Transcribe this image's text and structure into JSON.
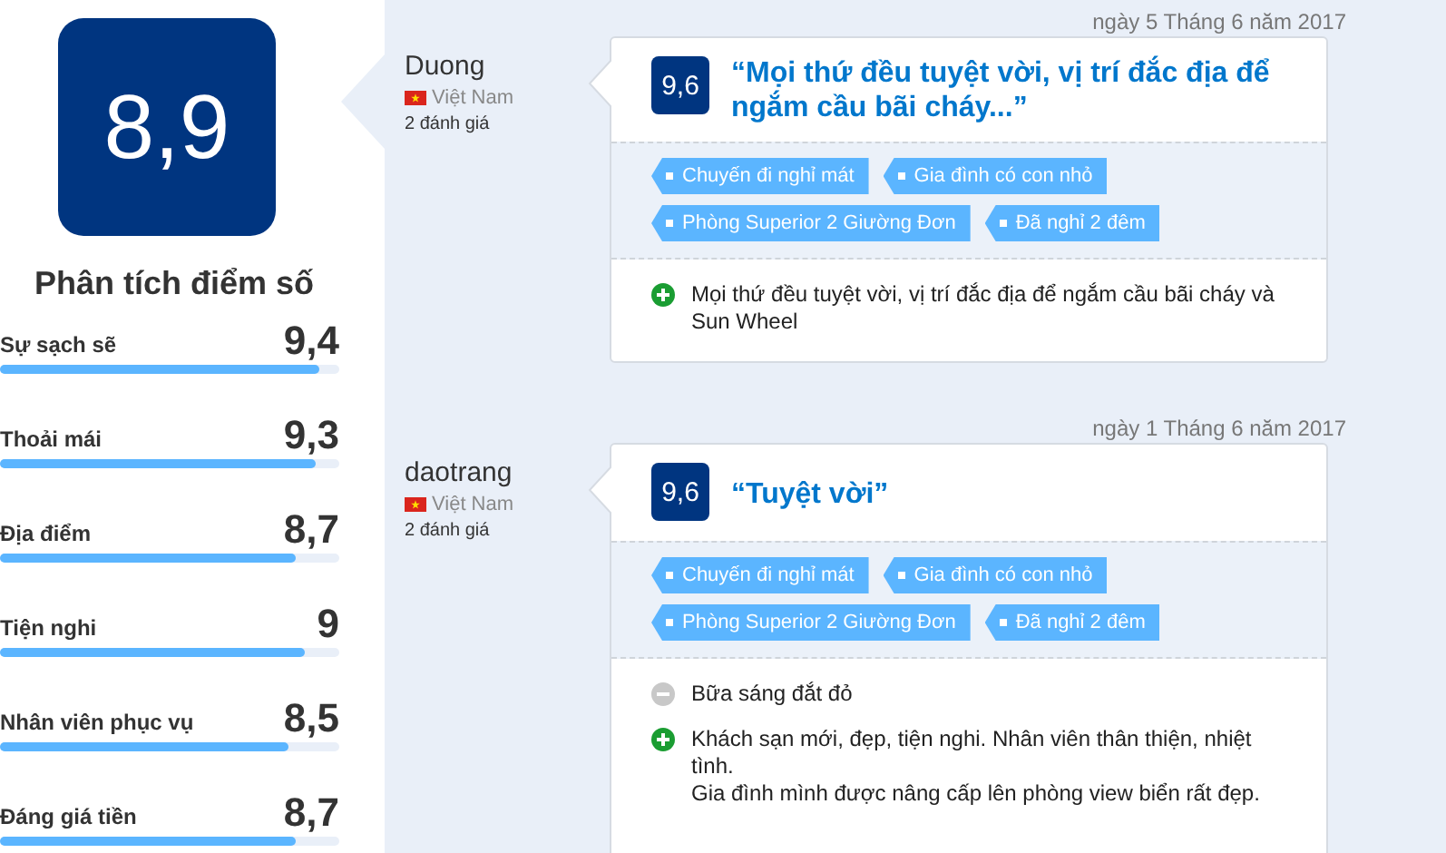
{
  "overall_score": "8,9",
  "breakdown": {
    "title": "Phân tích điểm số",
    "items": [
      {
        "label": "Sự sạch sẽ",
        "score": "9,4",
        "level": 0.94
      },
      {
        "label": "Thoải mái",
        "score": "9,3",
        "level": 0.93
      },
      {
        "label": "Địa điểm",
        "score": "8,7",
        "level": 0.87
      },
      {
        "label": "Tiện nghi",
        "score": "9",
        "level": 0.9
      },
      {
        "label": "Nhân viên phục vụ",
        "score": "8,5",
        "level": 0.85
      },
      {
        "label": "Đáng giá tiền",
        "score": "8,7",
        "level": 0.87
      }
    ]
  },
  "reviews": [
    {
      "date": "ngày 5 Tháng 6 năm 2017",
      "reviewer": "Duong",
      "country": "Việt Nam",
      "review_count": "2 đánh giá",
      "score": "9,6",
      "title": "“Mọi thứ đều tuyệt vời, vị trí đắc địa để ngắm cầu bãi cháy...”",
      "tags": [
        "Chuyến đi nghỉ mát",
        "Gia đình có con nhỏ",
        "Phòng Superior 2 Giường Đơn",
        "Đã nghỉ 2 đêm"
      ],
      "comments": [
        {
          "kind": "positive",
          "text": "Mọi thứ đều tuyệt vời, vị trí đắc địa để ngắm cầu bãi cháy và Sun Wheel"
        }
      ]
    },
    {
      "date": "ngày 1 Tháng 6 năm 2017",
      "reviewer": "daotrang",
      "country": "Việt Nam",
      "review_count": "2 đánh giá",
      "score": "9,6",
      "title": "“Tuyệt vời”",
      "tags": [
        "Chuyến đi nghỉ mát",
        "Gia đình có con nhỏ",
        "Phòng Superior 2 Giường Đơn",
        "Đã nghỉ 2 đêm"
      ],
      "comments": [
        {
          "kind": "negative",
          "text": "Bữa sáng đắt đỏ"
        },
        {
          "kind": "positive",
          "text": "Khách sạn mới, đẹp, tiện nghi. Nhân viên thân thiện, nhiệt tình.\nGia đình mình được nâng cấp lên phòng view biển rất đẹp."
        }
      ]
    }
  ]
}
